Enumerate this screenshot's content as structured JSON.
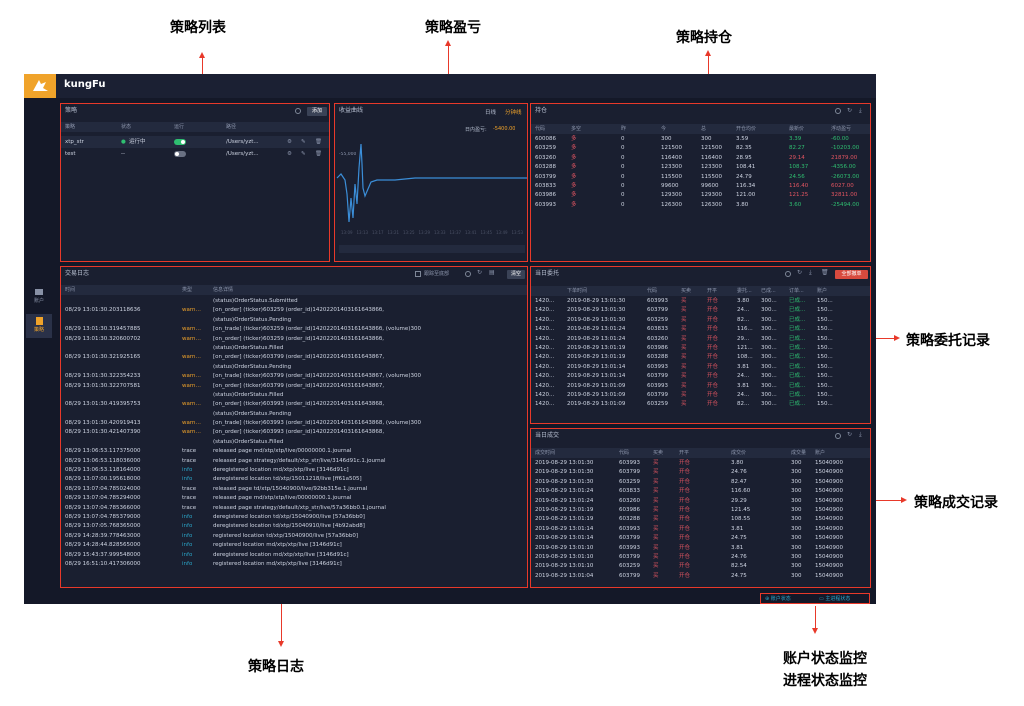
{
  "annotations": {
    "strategy_list": "策略列表",
    "strategy_pnl": "策略盈亏",
    "strategy_position": "策略持仓",
    "strategy_orders": "策略委托记录",
    "strategy_log": "策略日志",
    "strategy_trades": "策略成交记录",
    "account_monitor": "账户状态监控",
    "process_monitor": "进程状态监控"
  },
  "app": {
    "brand": "kungFu"
  },
  "nav": [
    {
      "label": "账户"
    },
    {
      "label": "策略"
    }
  ],
  "strategies": {
    "title": "策略",
    "add_button": "添加",
    "columns": [
      "策略",
      "状态",
      "运行",
      "路径"
    ],
    "rows": [
      {
        "name": "xtp_str",
        "status": "运行中",
        "running": true,
        "path": "/Users/yzt..."
      },
      {
        "name": "test",
        "status": "--",
        "running": false,
        "path": "/Users/yzt..."
      }
    ]
  },
  "pnl": {
    "title": "收益曲线",
    "tabs": [
      "日线",
      "分钟线"
    ],
    "active_tab": "分钟线",
    "intraday_label": "日内盈亏:",
    "intraday_value": "-5400.00",
    "y_tick": "-55,000"
  },
  "chart_data": {
    "type": "line",
    "title": "",
    "xlabel": "",
    "ylabel": "",
    "x": [
      "13:00",
      "13:09",
      "13:13",
      "13:17",
      "13:21",
      "13:25",
      "13:29",
      "13:33",
      "13:37",
      "13:41",
      "13:45",
      "13:49",
      "13:53"
    ],
    "x_tick_labels": [
      "13:09",
      "13:13",
      "13:17",
      "13:21",
      "13:25",
      "13:29",
      "13:33",
      "13:37",
      "13:41",
      "13:45",
      "13:49",
      "13:53"
    ]
  },
  "positions": {
    "title": "持仓",
    "columns": [
      "代码",
      "多空",
      "昨",
      "今",
      "总",
      "开仓均价",
      "最新价",
      "浮动盈亏"
    ],
    "rows": [
      [
        "600086",
        "多",
        "0",
        "300",
        "300",
        "3.59",
        "3.39",
        "-60.00"
      ],
      [
        "603259",
        "多",
        "0",
        "121500",
        "121500",
        "82.35",
        "82.27",
        "-10203.00"
      ],
      [
        "603260",
        "多",
        "0",
        "116400",
        "116400",
        "28.95",
        "29.14",
        "21879.00"
      ],
      [
        "603288",
        "多",
        "0",
        "123300",
        "123300",
        "108.41",
        "108.37",
        "-4356.00"
      ],
      [
        "603799",
        "多",
        "0",
        "115500",
        "115500",
        "24.79",
        "24.56",
        "-26073.00"
      ],
      [
        "603833",
        "多",
        "0",
        "99600",
        "99600",
        "116.34",
        "116.40",
        "6027.00"
      ],
      [
        "603986",
        "多",
        "0",
        "129300",
        "129300",
        "121.00",
        "121.25",
        "32811.00"
      ],
      [
        "603993",
        "多",
        "0",
        "126300",
        "126300",
        "3.80",
        "3.60",
        "-25494.00"
      ]
    ]
  },
  "log": {
    "title": "交易日志",
    "follow_label": "跟踪至底部",
    "clear_button": "清空",
    "columns": [
      "时间",
      "类型",
      "信息详情"
    ],
    "rows": [
      {
        "t": "",
        "type": "",
        "msg": "(status)OrderStatus.Submitted"
      },
      {
        "t": "08/29 13:01:30.203118636",
        "type": "warn…",
        "msg": "[on_order] (ticker)603259 (order_id)1420220140316164386б,"
      },
      {
        "t": "",
        "type": "",
        "msg": "(status)OrderStatus.Pending"
      },
      {
        "t": "08/29 13:01:30.319457885",
        "type": "warn…",
        "msg": "[on_trade] (ticker)603259 (order_id)1420220140316164386б, (volume)300"
      },
      {
        "t": "08/29 13:01:30.320600702",
        "type": "warn…",
        "msg": "[on_order] (ticker)603259 (order_id)1420220140316164386б,"
      },
      {
        "t": "",
        "type": "",
        "msg": "(status)OrderStatus.Filled"
      },
      {
        "t": "08/29 13:01:30.321925165",
        "type": "warn…",
        "msg": "[on_order] (ticker)603799 (order_id)14202201403161643867,"
      },
      {
        "t": "",
        "type": "",
        "msg": "(status)OrderStatus.Pending"
      },
      {
        "t": "08/29 13:01:30.322354233",
        "type": "warn…",
        "msg": "[on_trade] (ticker)603799 (order_id)14202201403161643867, (volume)300"
      },
      {
        "t": "08/29 13:01:30.322707581",
        "type": "warn…",
        "msg": "[on_order] (ticker)603799 (order_id)14202201403161643867,"
      },
      {
        "t": "",
        "type": "",
        "msg": "(status)OrderStatus.Filled"
      },
      {
        "t": "08/29 13:01:30.419395753",
        "type": "warn…",
        "msg": "[on_order] (ticker)603993 (order_id)14202201403161643868,"
      },
      {
        "t": "",
        "type": "",
        "msg": "(status)OrderStatus.Pending"
      },
      {
        "t": "08/29 13:01:30.420919413",
        "type": "warn…",
        "msg": "[on_trade] (ticker)603993 (order_id)14202201403161643868, (volume)300"
      },
      {
        "t": "08/29 13:01:30.421407390",
        "type": "warn…",
        "msg": "[on_order] (ticker)603993 (order_id)14202201403161643868,"
      },
      {
        "t": "",
        "type": "",
        "msg": "(status)OrderStatus.Filled"
      },
      {
        "t": "08/29 13:06:53.117375000",
        "type": "trace",
        "msg": "released page md/xtp/xtp/live/00000000.1.journal"
      },
      {
        "t": "08/29 13:06:53.118036000",
        "type": "trace",
        "msg": "released page strategy/default/xtp_str/live/3146d91c.1.journal"
      },
      {
        "t": "08/29 13:06:53.118164000",
        "type": "info",
        "msg": "deregistered location md/xtp/xtp/live [3146d91c]"
      },
      {
        "t": "08/29 13:07:00.195618000",
        "type": "info",
        "msg": "deregistered location td/xtp/15011218/live [ff61a505]"
      },
      {
        "t": "08/29 13:07:04.785024000",
        "type": "trace",
        "msg": "released page td/xtp/15040900/live/92bb315e.1.journal"
      },
      {
        "t": "08/29 13:07:04.785294000",
        "type": "trace",
        "msg": "released page md/xtp/xtp/live/00000000.1.journal"
      },
      {
        "t": "08/29 13:07:04.785366000",
        "type": "trace",
        "msg": "released page strategy/default/xtp_str/live/57a36bb0.1.journal"
      },
      {
        "t": "08/29 13:07:04.785379000",
        "type": "info",
        "msg": "deregistered location td/xtp/15040900/live [57a36bb0]"
      },
      {
        "t": "08/29 13:07:05.768365000",
        "type": "info",
        "msg": "deregistered location td/xtp/15040910/live [4b92abd8]"
      },
      {
        "t": "08/29 14:28:39.778463000",
        "type": "info",
        "msg": "registered location td/xtp/15040900/live [57a36bb0]"
      },
      {
        "t": "08/29 14:28:44.828565000",
        "type": "info",
        "msg": "registered location md/xtp/xtp/live [3146d91c]"
      },
      {
        "t": "08/29 15:43:37.999548000",
        "type": "info",
        "msg": "deregistered location md/xtp/xtp/live [3146d91c]"
      },
      {
        "t": "08/29 16:51:10.417306000",
        "type": "info",
        "msg": "registered location md/xtp/xtp/live [3146d91c]"
      }
    ]
  },
  "orders": {
    "title": "当日委托",
    "cancel_all_button": "全部撤单",
    "columns": [
      "",
      "下单时间",
      "代码",
      "买卖",
      "开平",
      "委托...",
      "已成...",
      "订单...",
      "账户"
    ],
    "rows": [
      [
        "1420...",
        "2019-08-29 13:01:30",
        "603993",
        "买",
        "开仓",
        "3.80",
        "300...",
        "已成...",
        "150..."
      ],
      [
        "1420...",
        "2019-08-29 13:01:30",
        "603799",
        "买",
        "开仓",
        "24...",
        "300...",
        "已成...",
        "150..."
      ],
      [
        "1420...",
        "2019-08-29 13:01:30",
        "603259",
        "买",
        "开仓",
        "82...",
        "300...",
        "已成...",
        "150..."
      ],
      [
        "1420...",
        "2019-08-29 13:01:24",
        "603833",
        "买",
        "开仓",
        "116...",
        "300...",
        "已成...",
        "150..."
      ],
      [
        "1420...",
        "2019-08-29 13:01:24",
        "603260",
        "买",
        "开仓",
        "29...",
        "300...",
        "已成...",
        "150..."
      ],
      [
        "1420...",
        "2019-08-29 13:01:19",
        "603986",
        "买",
        "开仓",
        "121...",
        "300...",
        "已成...",
        "150..."
      ],
      [
        "1420...",
        "2019-08-29 13:01:19",
        "603288",
        "买",
        "开仓",
        "108...",
        "300...",
        "已成...",
        "150..."
      ],
      [
        "1420...",
        "2019-08-29 13:01:14",
        "603993",
        "买",
        "开仓",
        "3.81",
        "300...",
        "已成...",
        "150..."
      ],
      [
        "1420...",
        "2019-08-29 13:01:14",
        "603799",
        "买",
        "开仓",
        "24...",
        "300...",
        "已成...",
        "150..."
      ],
      [
        "1420...",
        "2019-08-29 13:01:09",
        "603993",
        "买",
        "开仓",
        "3.81",
        "300...",
        "已成...",
        "150..."
      ],
      [
        "1420...",
        "2019-08-29 13:01:09",
        "603799",
        "买",
        "开仓",
        "24...",
        "300...",
        "已成...",
        "150..."
      ],
      [
        "1420...",
        "2019-08-29 13:01:09",
        "603259",
        "买",
        "开仓",
        "82...",
        "300...",
        "已成...",
        "150..."
      ]
    ]
  },
  "trades": {
    "title": "当日成交",
    "columns": [
      "成交时间",
      "代码",
      "买卖",
      "开平",
      "成交价",
      "成交量",
      "账户"
    ],
    "rows": [
      [
        "2019-08-29 13:01:30",
        "603993",
        "买",
        "开仓",
        "3.80",
        "300",
        "15040900"
      ],
      [
        "2019-08-29 13:01:30",
        "603799",
        "买",
        "开仓",
        "24.76",
        "300",
        "15040900"
      ],
      [
        "2019-08-29 13:01:30",
        "603259",
        "买",
        "开仓",
        "82.47",
        "300",
        "15040900"
      ],
      [
        "2019-08-29 13:01:24",
        "603833",
        "买",
        "开仓",
        "116.60",
        "300",
        "15040900"
      ],
      [
        "2019-08-29 13:01:24",
        "603260",
        "买",
        "开仓",
        "29.29",
        "300",
        "15040900"
      ],
      [
        "2019-08-29 13:01:19",
        "603986",
        "买",
        "开仓",
        "121.45",
        "300",
        "15040900"
      ],
      [
        "2019-08-29 13:01:19",
        "603288",
        "买",
        "开仓",
        "108.55",
        "300",
        "15040900"
      ],
      [
        "2019-08-29 13:01:14",
        "603993",
        "买",
        "开仓",
        "3.81",
        "300",
        "15040900"
      ],
      [
        "2019-08-29 13:01:14",
        "603799",
        "买",
        "开仓",
        "24.75",
        "300",
        "15040900"
      ],
      [
        "2019-08-29 13:01:10",
        "603993",
        "买",
        "开仓",
        "3.81",
        "300",
        "15040900"
      ],
      [
        "2019-08-29 13:01:10",
        "603799",
        "买",
        "开仓",
        "24.76",
        "300",
        "15040900"
      ],
      [
        "2019-08-29 13:01:10",
        "603259",
        "买",
        "开仓",
        "82.54",
        "300",
        "15040900"
      ],
      [
        "2019-08-29 13:01:04",
        "603799",
        "买",
        "开仓",
        "24.75",
        "300",
        "15040900"
      ]
    ]
  },
  "status": {
    "account": "账户状态",
    "process": "主进程状态"
  }
}
